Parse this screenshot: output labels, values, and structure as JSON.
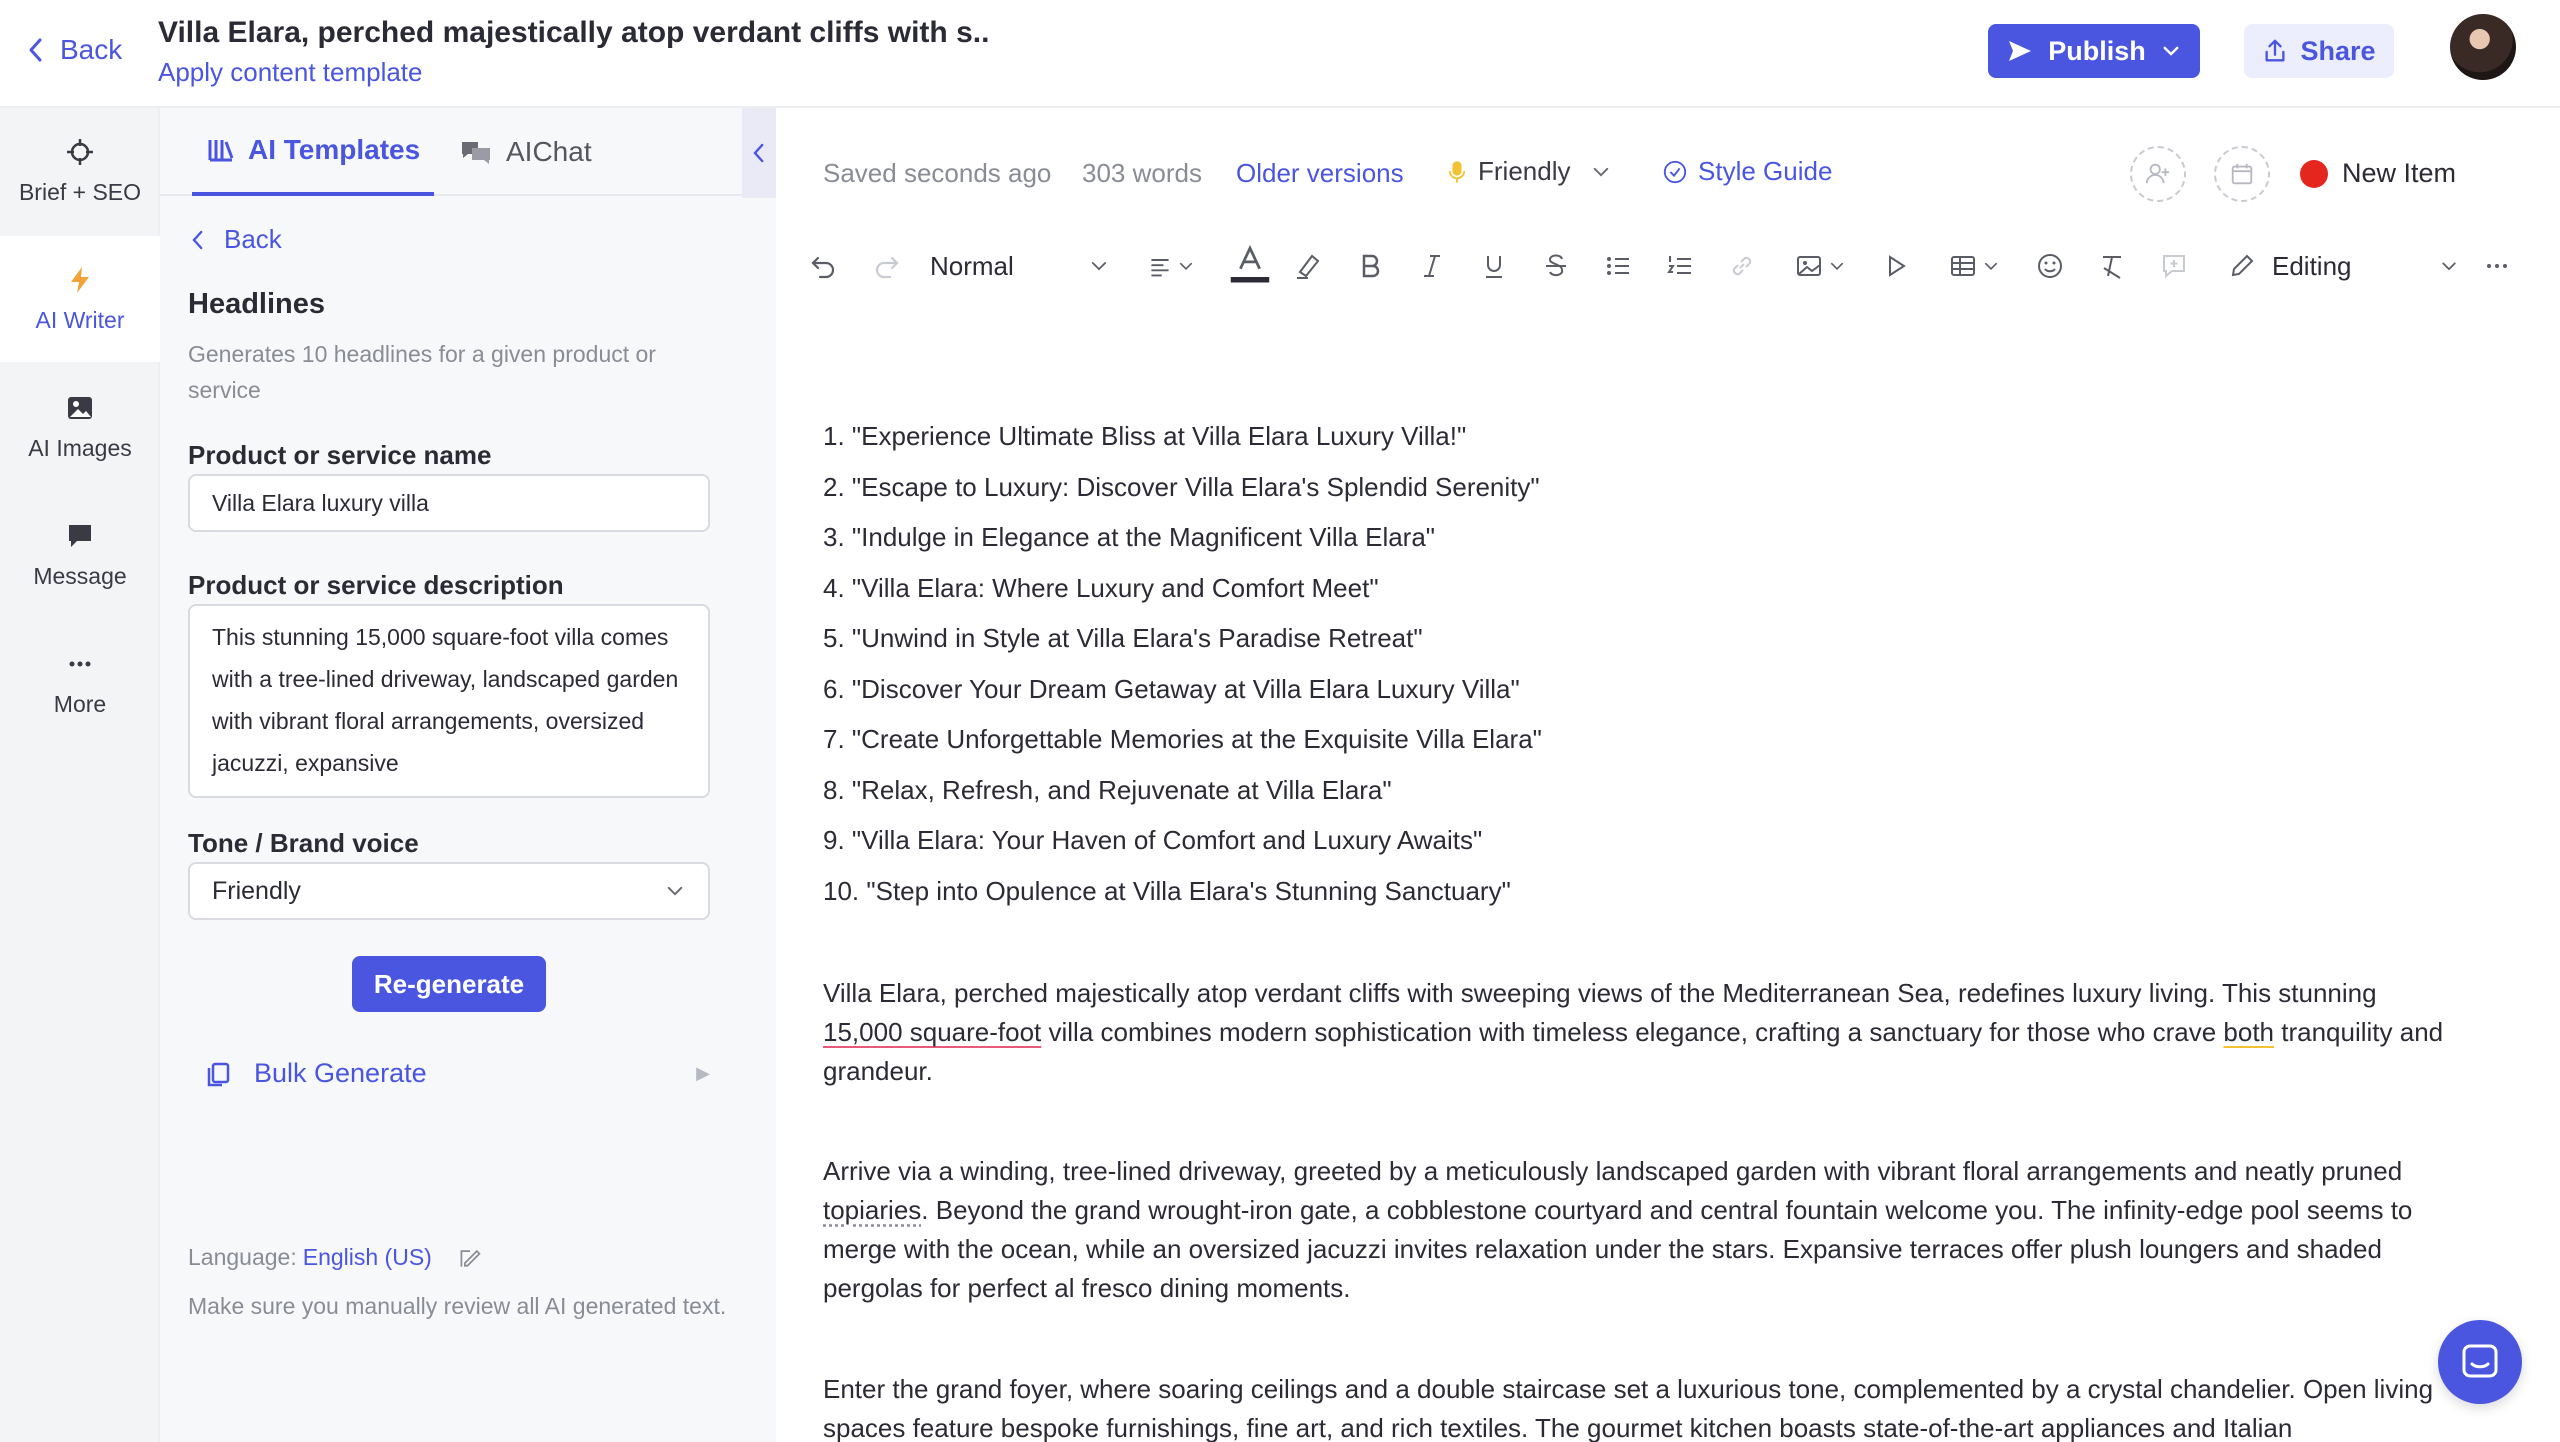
{
  "topbar": {
    "back_label": "Back",
    "title": "Villa Elara, perched majestically atop verdant cliffs with s..",
    "apply_template": "Apply content template",
    "publish_label": "Publish",
    "share_label": "Share",
    "brand_color": "#4a55e0"
  },
  "rail": {
    "items": [
      {
        "label": "Brief + SEO",
        "icon": "target-icon"
      },
      {
        "label": "AI Writer",
        "icon": "lightning-icon"
      },
      {
        "label": "AI Images",
        "icon": "image-icon"
      },
      {
        "label": "Message",
        "icon": "message-icon"
      },
      {
        "label": "More",
        "icon": "more-icon"
      }
    ],
    "active": "AI Writer"
  },
  "panel": {
    "tabs": [
      {
        "label": "AI Templates"
      },
      {
        "label": "AIChat"
      }
    ],
    "back_label": "Back",
    "section_title": "Headlines",
    "section_desc": "Generates 10 headlines for a given product or service",
    "name_label": "Product or service name",
    "name_value": "Villa Elara luxury villa",
    "desc_label": "Product or service description",
    "desc_value": "This stunning 15,000 square-foot villa comes with a tree-lined driveway, landscaped garden with vibrant floral arrangements, oversized jacuzzi, expansive",
    "tone_label": "Tone / Brand voice",
    "tone_value": "Friendly",
    "regenerate_label": "Re-generate",
    "bulk_label": "Bulk Generate",
    "language_label": "Language:",
    "language_value": "English (US)",
    "review_note": "Make sure you manually review all AI generated text."
  },
  "editor": {
    "saved": "Saved seconds ago",
    "words": "303 words",
    "older_versions": "Older versions",
    "tone": "Friendly",
    "style_guide": "Style Guide",
    "new_item": "New Item",
    "status_color": "#e5261f",
    "toolbar": {
      "paragraph_style": "Normal",
      "mode": "Editing"
    },
    "headlines": [
      "1. \"Experience Ultimate Bliss at Villa Elara Luxury Villa!\"",
      "2. \"Escape to Luxury: Discover Villa Elara's Splendid Serenity\"",
      "3. \"Indulge in Elegance at the Magnificent Villa Elara\"",
      "4. \"Villa Elara: Where Luxury and Comfort Meet\"",
      "5. \"Unwind in Style at Villa Elara's Paradise Retreat\"",
      "6. \"Discover Your Dream Getaway at Villa Elara Luxury Villa\"",
      "7. \"Create Unforgettable Memories at the Exquisite Villa Elara\"",
      "8. \"Relax, Refresh, and Rejuvenate at Villa Elara\"",
      "9. \"Villa Elara: Your Haven of Comfort and Luxury Awaits\"",
      "10. \"Step into Opulence at Villa Elara's Stunning Sanctuary\""
    ],
    "para1": {
      "a": "Villa Elara, perched majestically atop verdant cliffs with sweeping views of the Mediterranean Sea, redefines luxury living. This stunning ",
      "b": "15,000 square-foot",
      "c": " villa combines modern sophistication with timeless elegance, crafting a sanctuary for those who crave ",
      "d": "both",
      "e": " tranquility and grandeur."
    },
    "para2": {
      "a": "Arrive via a winding, tree-lined driveway, greeted by a meticulously landscaped garden with vibrant floral arrangements and neatly pruned ",
      "b": "topiaries",
      "c": ". Beyond the grand wrought-iron gate, a cobblestone courtyard and central fountain welcome you. The infinity-edge pool seems to merge with the ocean, while an oversized jacuzzi invites relaxation under the stars. Expansive terraces offer plush loungers and shaded pergolas for perfect al fresco dining moments."
    },
    "para3": "Enter the grand foyer, where soaring ceilings and a double staircase set a luxurious tone, complemented by a crystal chandelier. Open living spaces feature bespoke furnishings, fine art, and rich textiles. The gourmet kitchen boasts state-of-the-art appliances and Italian"
  }
}
